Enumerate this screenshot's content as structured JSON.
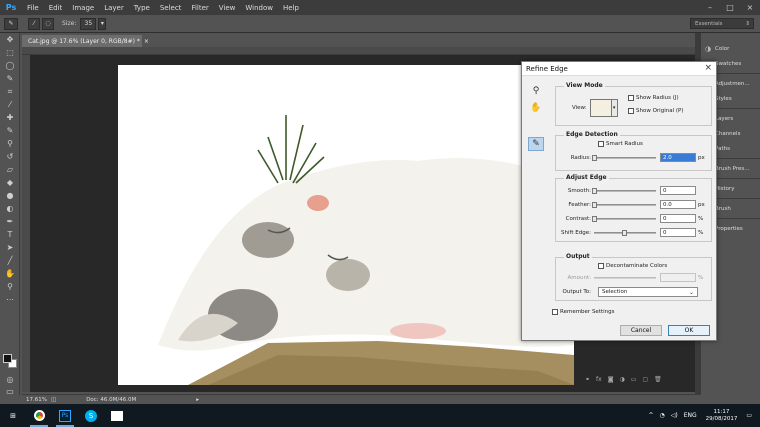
{
  "app": {
    "logo": "Ps"
  },
  "menu": [
    "File",
    "Edit",
    "Image",
    "Layer",
    "Type",
    "Select",
    "Filter",
    "View",
    "Window",
    "Help"
  ],
  "window_controls": [
    "–",
    "□",
    "×"
  ],
  "options_bar": {
    "size_label": "Size:",
    "size_value": "35",
    "workspace": "Essentials"
  },
  "document": {
    "tab_title": "Cat.jpg @ 17.6% (Layer 0, RGB/8#) *",
    "close": "×"
  },
  "status": {
    "zoom": "17.61%",
    "doc_info": "Doc: 46.0M/46.0M"
  },
  "panels": [
    {
      "label": "Color",
      "icon": "color-icon"
    },
    {
      "label": "Swatches",
      "icon": "swatches-icon"
    },
    {
      "label": "Adjustmen...",
      "icon": "adjustments-icon"
    },
    {
      "label": "Styles",
      "icon": "styles-icon"
    },
    {
      "label": "Layers",
      "icon": "layers-icon"
    },
    {
      "label": "Channels",
      "icon": "channels-icon"
    },
    {
      "label": "Paths",
      "icon": "paths-icon"
    },
    {
      "label": "Brush Pres...",
      "icon": "brush-presets-icon"
    },
    {
      "label": "History",
      "icon": "history-icon"
    },
    {
      "label": "Brush",
      "icon": "brush-icon"
    },
    {
      "label": "Properties",
      "icon": "properties-icon"
    }
  ],
  "dialog": {
    "title": "Refine Edge",
    "close": "×",
    "view_mode": {
      "title": "View Mode",
      "view_label": "View:",
      "show_radius": "Show Radius (J)",
      "show_original": "Show Original (P)"
    },
    "edge_detection": {
      "title": "Edge Detection",
      "smart_radius": "Smart Radius",
      "radius_label": "Radius:",
      "radius_value": "2.0",
      "radius_unit": "px"
    },
    "adjust_edge": {
      "title": "Adjust Edge",
      "smooth_label": "Smooth:",
      "smooth_value": "0",
      "feather_label": "Feather:",
      "feather_value": "0.0",
      "feather_unit": "px",
      "contrast_label": "Contrast:",
      "contrast_value": "0",
      "contrast_unit": "%",
      "shift_label": "Shift Edge:",
      "shift_value": "0",
      "shift_unit": "%"
    },
    "output": {
      "title": "Output",
      "decontaminate": "Decontaminate Colors",
      "amount_label": "Amount:",
      "amount_unit": "%",
      "output_to_label": "Output To:",
      "output_to_value": "Selection"
    },
    "remember": "Remember Settings",
    "cancel": "Cancel",
    "ok": "OK"
  },
  "taskbar": {
    "time": "11:17",
    "date": "29/08/2017",
    "lang": "ENG"
  }
}
